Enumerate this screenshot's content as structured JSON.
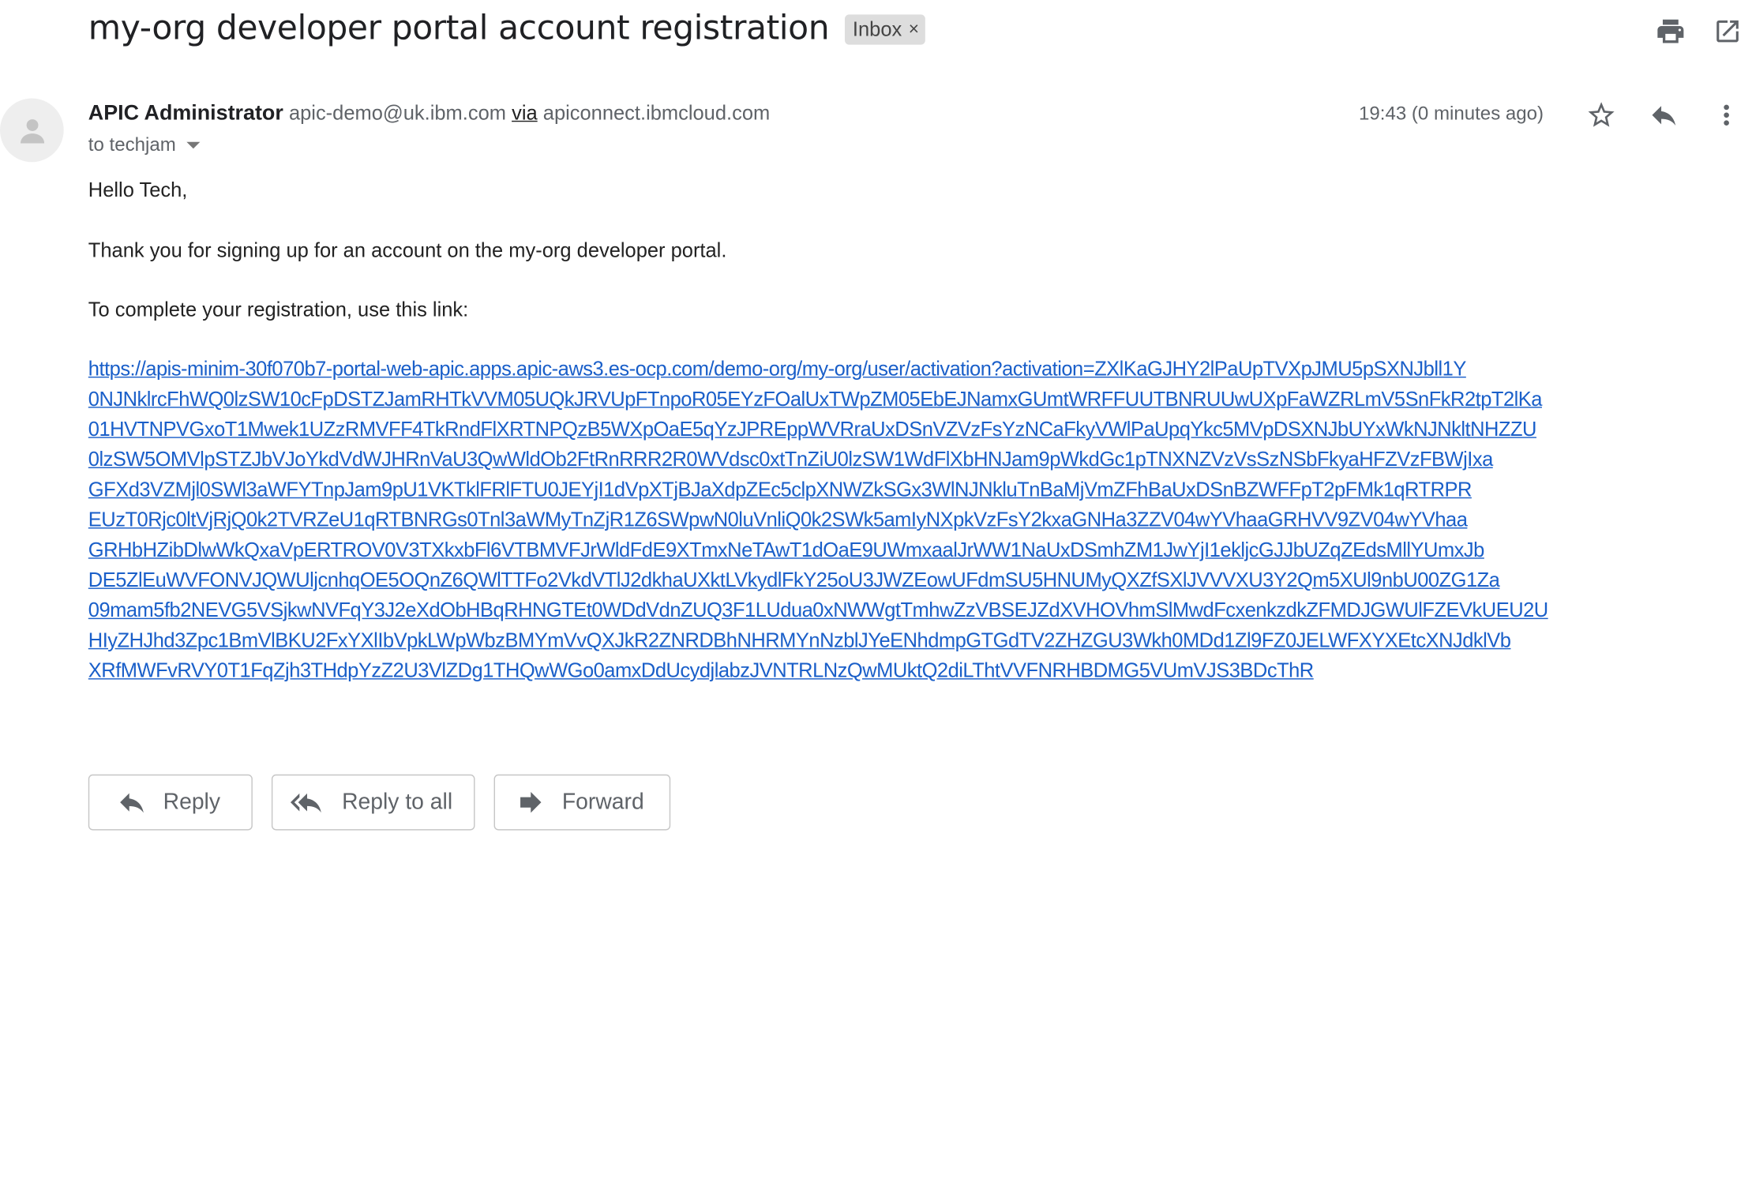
{
  "subject": "my-org developer portal account registration",
  "label_chip": {
    "text": "Inbox",
    "close": "×"
  },
  "toolbar_icons": [
    "print-icon",
    "open-new-window-icon"
  ],
  "sender": {
    "name": "APIC Administrator",
    "email": "apic-demo@uk.ibm.com",
    "via_label": "via",
    "via_domain": "apiconnect.ibmcloud.com"
  },
  "recipient": "to techjam",
  "timestamp": "19:43 (0 minutes ago)",
  "message_icons": [
    "star-icon",
    "reply-icon",
    "more-vert-icon"
  ],
  "body": {
    "greeting": "Hello Tech,",
    "line1": "Thank you for signing up for an account on the my-org developer portal.",
    "line2": "To complete your registration, use this link:",
    "link_lines": [
      "https://apis-minim-30f070b7-portal-web-apic.apps.apic-aws3.es-ocp.com/demo-org/my-org/user/activation?activation=ZXlKaGJHY2lPaUpTVXpJMU5pSXNJbll1Y",
      "0NJNklrcFhWQ0lzSW10cFpDSTZJamRHTkVVM05UQkJRVUpFTnpoR05EYzFOalUxTWpZM05EbEJNamxGUmtWRFFUUTBNRUUwUXpFaWZRLmV5SnFkR2tpT2lKa",
      "01HVTNPVGxoT1Mwek1UZzRMVFF4TkRndFlXRTNPQzB5WXpOaE5qYzJPREppWVRraUxDSnVZVzFsYzNCaFkyVWlPaUpqYkc5MVpDSXNJbUYxWkNJNkltNHZZU",
      "0lzSW5OMVlpSTZJbVJoYkdVdWJHRnVaU3QwWldOb2FtRnRRR2R0WVdsc0xtTnZiU0lzSW1WdFlXbHNJam9pWkdGc1pTNXNZVzVsSzNSbFkyaHFZVzFBWjIxa",
      "GFXd3VZMjl0SWl3aWFYTnpJam9pU1VKTklFRlFTU0JEYjI1dVpXTjBJaXdpZEc5clpXNWZkSGx3WlNJNkluTnBaMjVmZFhBaUxDSnBZWFFpT2pFMk1qRTRPR",
      "EUzT0Rjc0ltVjRjQ0k2TVRZeU1qRTBNRGs0Tnl3aWMyTnZjR1Z6SWpwN0luVnliQ0k2SWk5amIyNXpkVzFsY2kxaGNHa3ZZV04wYVhaaGRHVV9ZV04wYVhaa",
      "GRHbHZibDlwWkQxaVpERTROV0V3TXkxbFl6VTBMVFJrWldFdE9XTmxNeTAwT1dOaE9UWmxaalJrWW1NaUxDSmhZM1JwYjI1ekljcGJJbUZqZEdsMllYUmxJb",
      "DE5ZlEuWVFONVJQWUljcnhqOE5OQnZ6QWlTTFo2VkdVTlJ2dkhaUXktLVkydlFkY25oU3JWZEowUFdmSU5HNUMyQXZfSXlJVVVXU3Y2Qm5XUl9nbU00ZG1Za",
      "09mam5fb2NEVG5VSjkwNVFqY3J2eXdObHBqRHNGTEt0WDdVdnZUQ3F1LUdua0xNWWgtTmhwZzVBSEJZdXVHOVhmSlMwdFcxenkzdkZFMDJGWUlFZEVkUEU2U",
      "HIyZHJhd3Zpc1BmVlBKU2FxYXlIbVpkLWpWbzBMYmVvQXJkR2ZNRDBhNHRMYnNzblJYeENhdmpGTGdTV2ZHZGU3Wkh0MDd1Zl9FZ0JELWFXYXEtcXNJdklVb",
      "XRfMWFvRVY0T1FqZjh3THdpYzZ2U3VlZDg1THQwWGo0amxDdUcydjlabzJVNTRLNzQwMUktQ2diLThtVVFNRHBDMG5VUmVJS3BDcThR"
    ]
  },
  "actions": {
    "reply": "Reply",
    "reply_all": "Reply to all",
    "forward": "Forward"
  },
  "colors": {
    "link": "#1a5fc9",
    "chip_bg": "#dddddd",
    "muted_text": "#5f6368",
    "icon": "#5f6368"
  }
}
